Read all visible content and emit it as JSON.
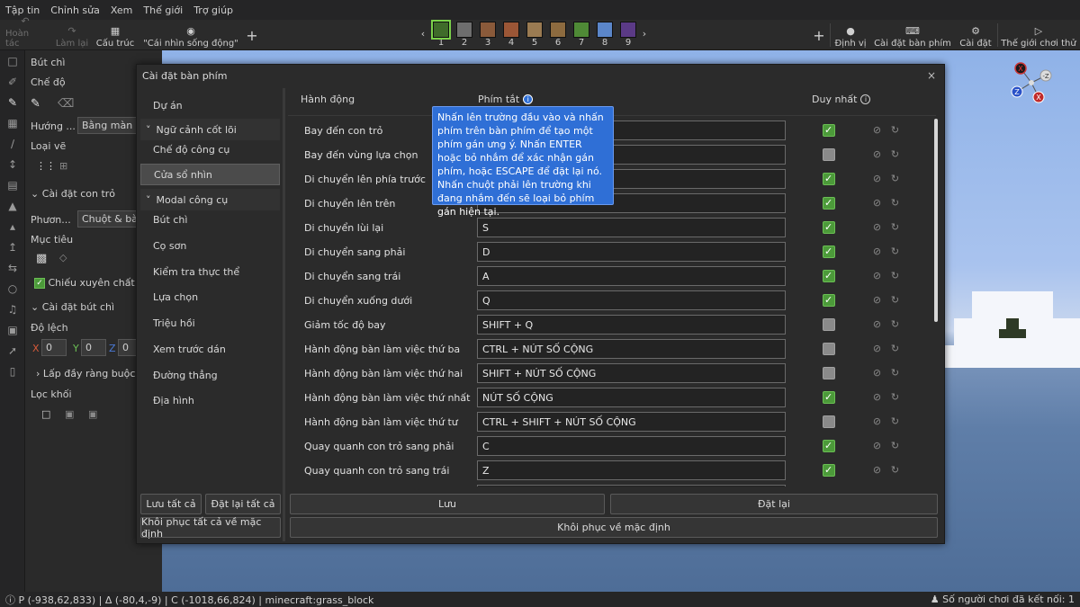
{
  "menubar": {
    "items": [
      "Tập tin",
      "Chỉnh sửa",
      "Xem",
      "Thế giới",
      "Trợ giúp"
    ]
  },
  "toolbar": {
    "undo": "Hoàn tác",
    "redo": "Làm lại",
    "structure": "Cấu trúc",
    "view_mode": "\"Cái nhìn sống động\"",
    "hotbar": [
      "1",
      "2",
      "3",
      "4",
      "5",
      "6",
      "7",
      "8",
      "9"
    ],
    "hotbar_colors": [
      "#3f6b2a",
      "#6e6e6e",
      "#8a5a3a",
      "#9b5636",
      "#9a7b52",
      "#8d6b3f",
      "#4f8a36",
      "#5b86c9",
      "#5b3a86"
    ],
    "position": "Định vị",
    "keybind_settings": "Cài đặt bàn phím",
    "settings": "Cài đặt",
    "play_world": "Thế giới chơi thử"
  },
  "sidepanel": {
    "title": "Bút chì",
    "mode": "Chế độ",
    "direction_label": "Hướng ...",
    "direction_value": "Bằng màn ...",
    "draw_type": "Loại vẽ",
    "cursor_settings": "Cài đặt con trỏ",
    "method_label": "Phươn...",
    "method_value": "Chuột & bà...",
    "target": "Mục tiêu",
    "see_through": "Chiếu xuyên chất lỏ...",
    "pencil_settings": "Cài đặt bút chì",
    "offset": "Độ lệch",
    "x": "0",
    "y": "0",
    "z": "0",
    "fill_constraint": "Lấp đầy ràng buộc",
    "block_filter": "Lọc khối"
  },
  "dialog": {
    "title": "Cài đặt bàn phím",
    "close": "×",
    "categories": [
      {
        "label": "Dự án",
        "type": "item"
      },
      {
        "label": "Ngữ cảnh cốt lõi",
        "type": "header"
      },
      {
        "label": "Chế độ công cụ",
        "type": "item"
      },
      {
        "label": "Cửa sổ nhìn",
        "type": "selected"
      },
      {
        "label": "Modal công cụ",
        "type": "header"
      },
      {
        "label": "Bút chì",
        "type": "item"
      },
      {
        "label": "Cọ sơn",
        "type": "item"
      },
      {
        "label": "Kiểm tra thực thể",
        "type": "item"
      },
      {
        "label": "Lựa chọn",
        "type": "item"
      },
      {
        "label": "Triệu hồi",
        "type": "item"
      },
      {
        "label": "Xem trước dán",
        "type": "item"
      },
      {
        "label": "Đường thẳng",
        "type": "item"
      },
      {
        "label": "Địa hình",
        "type": "item"
      }
    ],
    "save_all": "Lưu tất cả",
    "reset_all": "Đặt lại tất cả",
    "restore_all_defaults": "Khôi phục tất cả về mặc định",
    "col_action": "Hành động",
    "col_shortcut": "Phím tắt",
    "col_unique": "Duy nhất",
    "rows": [
      {
        "action": "Bay đến con trỏ",
        "key": "",
        "unique": true
      },
      {
        "action": "Bay đến vùng lựa chọn",
        "key": "",
        "unique": false
      },
      {
        "action": "Di chuyển lên phía trước",
        "key": "",
        "unique": true
      },
      {
        "action": "Di chuyển lên trên",
        "key": "",
        "unique": true
      },
      {
        "action": "Di chuyển lùi lại",
        "key": "S",
        "unique": true
      },
      {
        "action": "Di chuyển sang phải",
        "key": "D",
        "unique": true
      },
      {
        "action": "Di chuyển sang trái",
        "key": "A",
        "unique": true
      },
      {
        "action": "Di chuyển xuống dưới",
        "key": "Q",
        "unique": true
      },
      {
        "action": "Giảm tốc độ bay",
        "key": "SHIFT + Q",
        "unique": false
      },
      {
        "action": "Hành động bàn làm việc thứ ba",
        "key": "CTRL + NÚT SỐ CỘNG",
        "unique": false
      },
      {
        "action": "Hành động bàn làm việc thứ hai",
        "key": "SHIFT + NÚT SỐ CỘNG",
        "unique": false
      },
      {
        "action": "Hành động bàn làm việc thứ nhất",
        "key": "NÚT SỐ CỘNG",
        "unique": true
      },
      {
        "action": "Hành động bàn làm việc thứ tư",
        "key": "CTRL + SHIFT + NÚT SỐ CỘNG",
        "unique": false
      },
      {
        "action": "Quay quanh con trỏ sang phải",
        "key": "C",
        "unique": true
      },
      {
        "action": "Quay quanh con trỏ sang trái",
        "key": "Z",
        "unique": true
      },
      {
        "action": "",
        "key": "",
        "unique": false
      }
    ],
    "save": "Lưu",
    "reset": "Đặt lại",
    "restore_defaults": "Khôi phục về mặc định",
    "tooltip": "Nhấn lên trường đầu vào và nhấn phím trên bàn phím để tạo một phím gán ưng ý. Nhấn ENTER hoặc bỏ nhắm để xác nhận gán phím, hoặc ESCAPE để đặt lại nó. Nhấn chuột phải lên trường khi đang nhắm đến sẽ loại bỏ phím gán hiện tại."
  },
  "statusbar": {
    "coords": "P (-938,62,833) | Δ (-80,4,-9) | C (-1018,66,824) | minecraft:grass_block",
    "players": "Số người chơi đã kết nối: 1"
  },
  "compass": {
    "x": "X",
    "z": "Z",
    "neg_z": "-Z",
    "neg_x": "X"
  }
}
